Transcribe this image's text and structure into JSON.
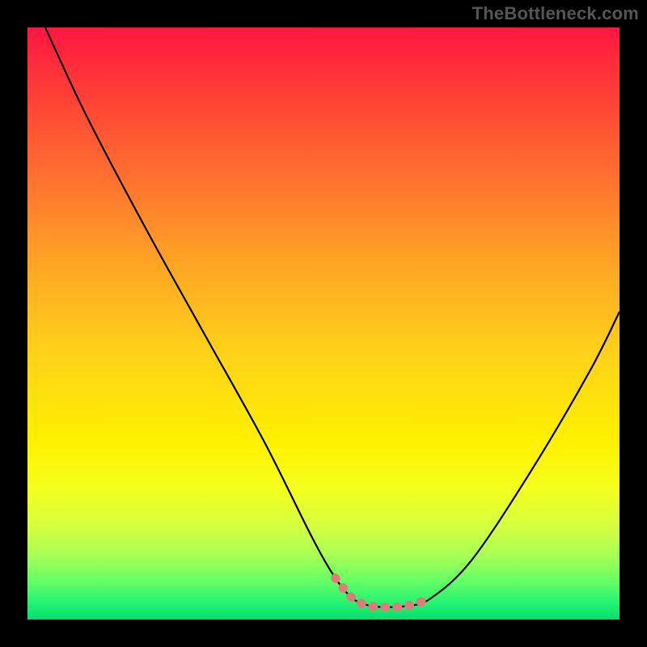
{
  "watermark": "TheBottleneck.com",
  "chart_data": {
    "type": "line",
    "title": "",
    "xlabel": "",
    "ylabel": "",
    "xlim": [
      0,
      100
    ],
    "ylim": [
      0,
      100
    ],
    "grid": false,
    "legend": false,
    "series": [
      {
        "name": "curve",
        "color": "#000000",
        "x": [
          3,
          10,
          20,
          30,
          40,
          48,
          52,
          55,
          58,
          61,
          64,
          68,
          75,
          85,
          95,
          100
        ],
        "y": [
          100,
          85,
          66,
          48,
          30,
          14,
          7,
          3.5,
          2.3,
          2.1,
          2.3,
          3.5,
          10,
          25,
          42,
          52
        ]
      },
      {
        "name": "highlight",
        "color": "#e27a7a",
        "x": [
          52,
          55,
          58,
          61,
          64,
          68
        ],
        "y": [
          7,
          3.5,
          2.3,
          2.1,
          2.3,
          3.5
        ]
      }
    ],
    "annotations": []
  },
  "colors": {
    "background": "#000000",
    "curve": "#000000",
    "highlight": "#e27a7a",
    "watermark": "#555555"
  }
}
